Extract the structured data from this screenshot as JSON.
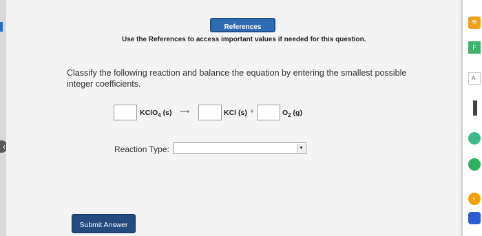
{
  "references_button": "References",
  "references_note": "Use the References to access important values if needed for this question.",
  "question_text": "Classify the following reaction and balance the equation by entering the smallest possible integer coefficients.",
  "equation": {
    "reactant": {
      "formula": "KClO",
      "subscript": "4",
      "state": "(s)"
    },
    "arrow": "⟶",
    "product1": {
      "formula": "KCl",
      "state": "(s)"
    },
    "plus": "+",
    "product2": {
      "formula": "O",
      "subscript": "2",
      "state": "(g)"
    },
    "coefficients": [
      "",
      "",
      ""
    ]
  },
  "reaction_type": {
    "label": "Reaction Type:",
    "selected": ""
  },
  "submit_button": "Submit Answer",
  "right_panel": {
    "a_label": "A-",
    "f_label": "F"
  },
  "colors": {
    "accent": "#2f6bb5",
    "submit": "#244a7e"
  }
}
